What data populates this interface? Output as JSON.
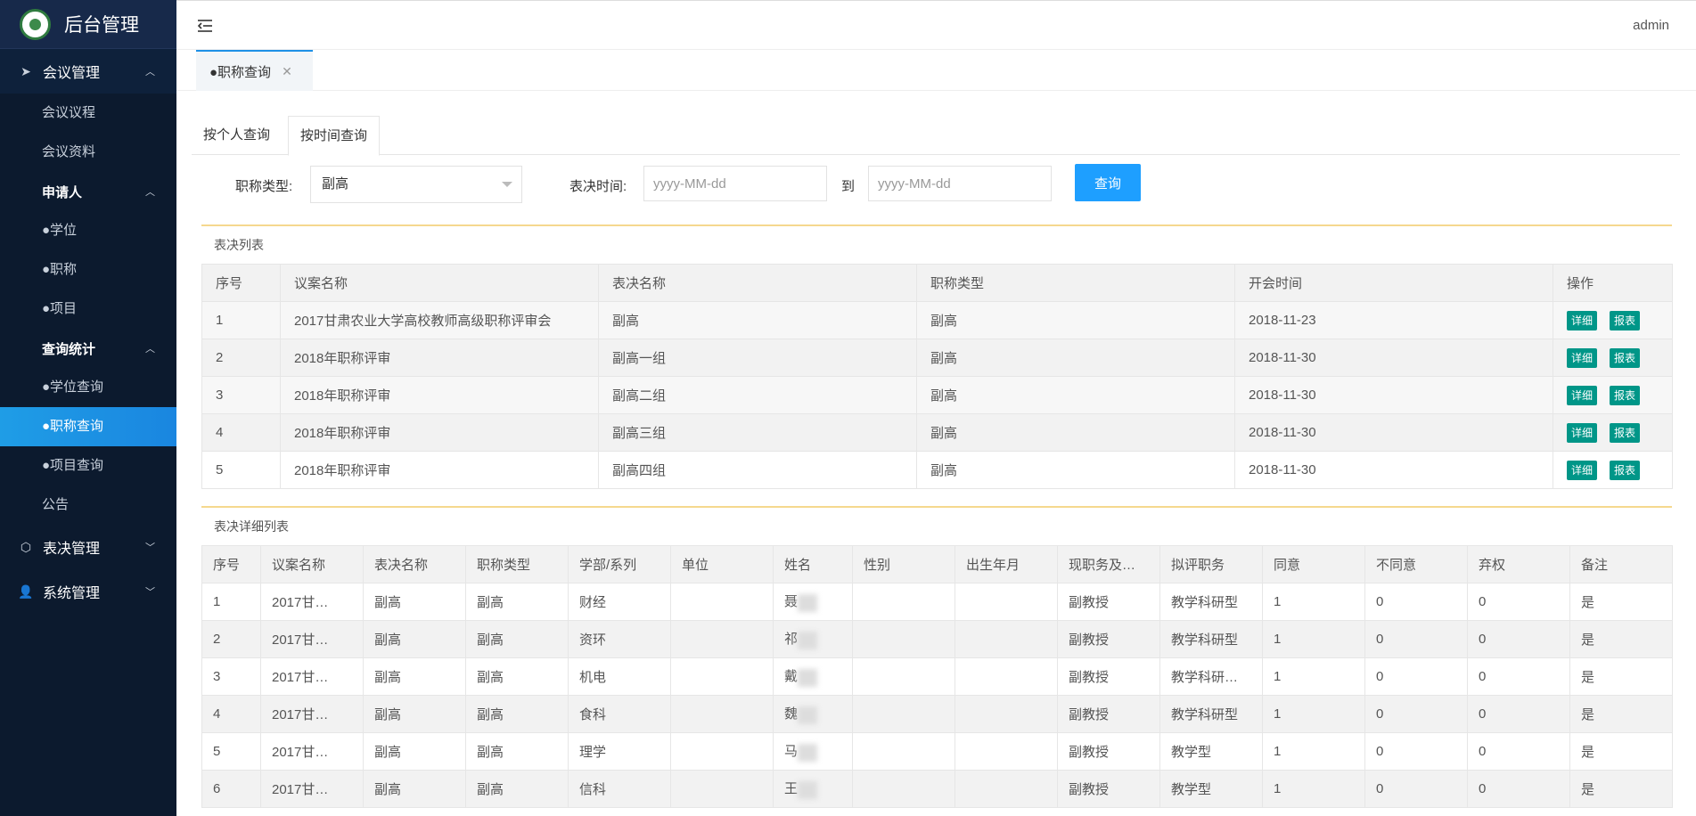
{
  "app": {
    "title": "后台管理"
  },
  "sidebar": {
    "meeting": {
      "label": "会议管理",
      "items": [
        "会议议程",
        "会议资料"
      ]
    },
    "applicant": {
      "label": "申请人",
      "items": [
        "●学位",
        "●职称",
        "●项目"
      ]
    },
    "stats": {
      "label": "查询统计",
      "items": [
        "●学位查询",
        "●职称查询",
        "●项目查询"
      ]
    },
    "notice": "公告",
    "vote": {
      "label": "表决管理"
    },
    "system": {
      "label": "系统管理"
    }
  },
  "header": {
    "user": "admin"
  },
  "tabbar": {
    "tab_label": "●职称查询",
    "close": "✕"
  },
  "query": {
    "tab_person": "按个人查询",
    "tab_time": "按时间查询",
    "title_type_label": "职称类型:",
    "title_type_value": "副高",
    "time_label": "表决时间:",
    "date_placeholder": "yyyy-MM-dd",
    "to_label": "到",
    "submit": "查询"
  },
  "vote_list": {
    "title": "表决列表",
    "columns": [
      "序号",
      "议案名称",
      "表决名称",
      "职称类型",
      "开会时间",
      "操作"
    ],
    "detail_btn": "详细",
    "report_btn": "报表",
    "rows": [
      [
        "1",
        "2017甘肃农业大学高校教师高级职称评审会",
        "副高",
        "副高",
        "2018-11-23"
      ],
      [
        "2",
        "2018年职称评审",
        "副高一组",
        "副高",
        "2018-11-30"
      ],
      [
        "3",
        "2018年职称评审",
        "副高二组",
        "副高",
        "2018-11-30"
      ],
      [
        "4",
        "2018年职称评审",
        "副高三组",
        "副高",
        "2018-11-30"
      ],
      [
        "5",
        "2018年职称评审",
        "副高四组",
        "副高",
        "2018-11-30"
      ]
    ]
  },
  "detail_list": {
    "title": "表决详细列表",
    "columns": [
      "序号",
      "议案名称",
      "表决名称",
      "职称类型",
      "学部/系列",
      "单位",
      "姓名",
      "性别",
      "出生年月",
      "现职务及…",
      "拟评职务",
      "同意",
      "不同意",
      "弃权",
      "备注"
    ],
    "rows": [
      [
        "1",
        "2017甘…",
        "副高",
        "副高",
        "财经",
        "",
        "聂",
        "",
        "",
        "副教授",
        "教学科研型",
        "1",
        "0",
        "0",
        "是"
      ],
      [
        "2",
        "2017甘…",
        "副高",
        "副高",
        "资环",
        "",
        "祁",
        "",
        "",
        "副教授",
        "教学科研型",
        "1",
        "0",
        "0",
        "是"
      ],
      [
        "3",
        "2017甘…",
        "副高",
        "副高",
        "机电",
        "",
        "戴",
        "",
        "",
        "副教授",
        "教学科研…",
        "1",
        "0",
        "0",
        "是"
      ],
      [
        "4",
        "2017甘…",
        "副高",
        "副高",
        "食科",
        "",
        "魏",
        "",
        "",
        "副教授",
        "教学科研型",
        "1",
        "0",
        "0",
        "是"
      ],
      [
        "5",
        "2017甘…",
        "副高",
        "副高",
        "理学",
        "",
        "马",
        "",
        "",
        "副教授",
        "教学型",
        "1",
        "0",
        "0",
        "是"
      ],
      [
        "6",
        "2017甘…",
        "副高",
        "副高",
        "信科",
        "",
        "王",
        "",
        "",
        "副教授",
        "教学型",
        "1",
        "0",
        "0",
        "是"
      ]
    ]
  }
}
